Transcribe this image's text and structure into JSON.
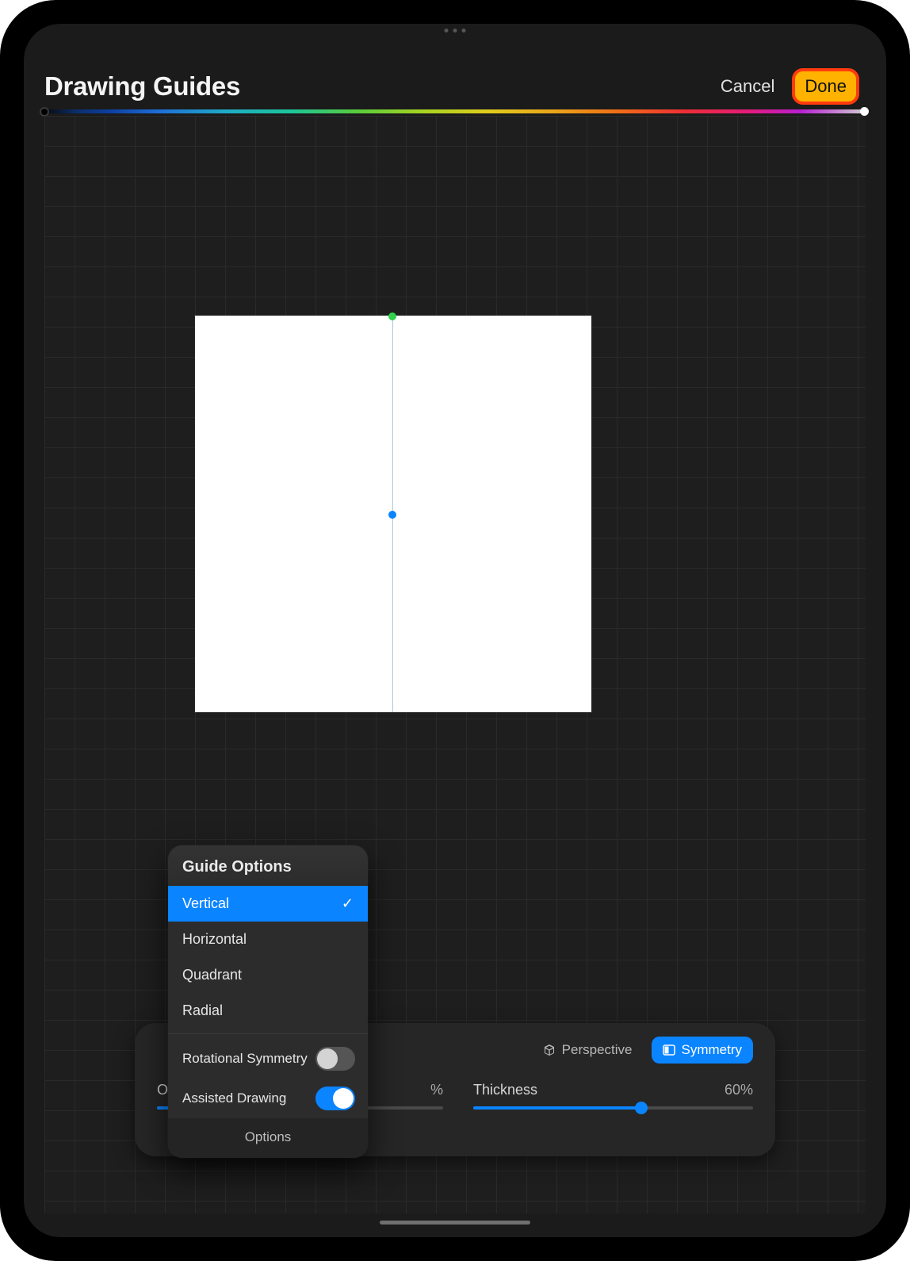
{
  "header": {
    "title": "Drawing Guides",
    "cancel": "Cancel",
    "done": "Done"
  },
  "toolbar": {
    "tabs": {
      "perspective": "Perspective",
      "symmetry": "Symmetry",
      "active": "symmetry"
    },
    "opacity": {
      "label": "O",
      "value_text": "%",
      "pct": 45
    },
    "thickness": {
      "label": "Thickness",
      "value_text": "60%",
      "pct": 60
    }
  },
  "popover": {
    "title": "Guide Options",
    "items": [
      {
        "label": "Vertical",
        "selected": true
      },
      {
        "label": "Horizontal",
        "selected": false
      },
      {
        "label": "Quadrant",
        "selected": false
      },
      {
        "label": "Radial",
        "selected": false
      }
    ],
    "rotational": {
      "label": "Rotational Symmetry",
      "on": false
    },
    "assisted": {
      "label": "Assisted Drawing",
      "on": true
    },
    "options_label": "Options"
  },
  "colors": {
    "accent": "#0a84ff",
    "done_highlight": "#ff3b0e"
  }
}
